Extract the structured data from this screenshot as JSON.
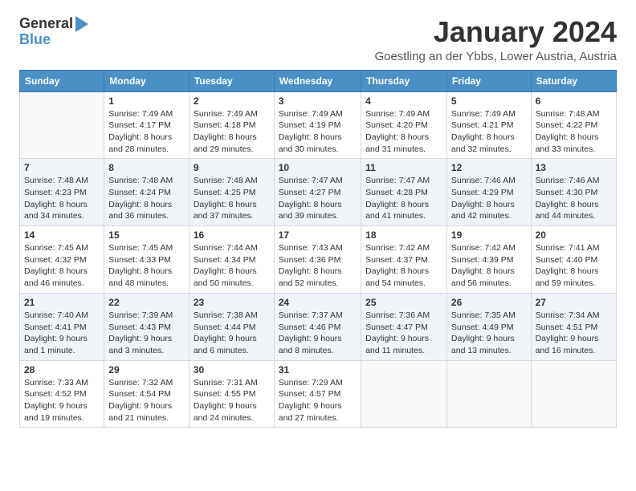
{
  "logo": {
    "text_general": "General",
    "text_blue": "Blue"
  },
  "title": "January 2024",
  "subtitle": "Goestling an der Ybbs, Lower Austria, Austria",
  "days_header": [
    "Sunday",
    "Monday",
    "Tuesday",
    "Wednesday",
    "Thursday",
    "Friday",
    "Saturday"
  ],
  "weeks": [
    [
      {
        "day": "",
        "info": ""
      },
      {
        "day": "1",
        "info": "Sunrise: 7:49 AM\nSunset: 4:17 PM\nDaylight: 8 hours\nand 28 minutes."
      },
      {
        "day": "2",
        "info": "Sunrise: 7:49 AM\nSunset: 4:18 PM\nDaylight: 8 hours\nand 29 minutes."
      },
      {
        "day": "3",
        "info": "Sunrise: 7:49 AM\nSunset: 4:19 PM\nDaylight: 8 hours\nand 30 minutes."
      },
      {
        "day": "4",
        "info": "Sunrise: 7:49 AM\nSunset: 4:20 PM\nDaylight: 8 hours\nand 31 minutes."
      },
      {
        "day": "5",
        "info": "Sunrise: 7:49 AM\nSunset: 4:21 PM\nDaylight: 8 hours\nand 32 minutes."
      },
      {
        "day": "6",
        "info": "Sunrise: 7:48 AM\nSunset: 4:22 PM\nDaylight: 8 hours\nand 33 minutes."
      }
    ],
    [
      {
        "day": "7",
        "info": "Sunrise: 7:48 AM\nSunset: 4:23 PM\nDaylight: 8 hours\nand 34 minutes."
      },
      {
        "day": "8",
        "info": "Sunrise: 7:48 AM\nSunset: 4:24 PM\nDaylight: 8 hours\nand 36 minutes."
      },
      {
        "day": "9",
        "info": "Sunrise: 7:48 AM\nSunset: 4:25 PM\nDaylight: 8 hours\nand 37 minutes."
      },
      {
        "day": "10",
        "info": "Sunrise: 7:47 AM\nSunset: 4:27 PM\nDaylight: 8 hours\nand 39 minutes."
      },
      {
        "day": "11",
        "info": "Sunrise: 7:47 AM\nSunset: 4:28 PM\nDaylight: 8 hours\nand 41 minutes."
      },
      {
        "day": "12",
        "info": "Sunrise: 7:46 AM\nSunset: 4:29 PM\nDaylight: 8 hours\nand 42 minutes."
      },
      {
        "day": "13",
        "info": "Sunrise: 7:46 AM\nSunset: 4:30 PM\nDaylight: 8 hours\nand 44 minutes."
      }
    ],
    [
      {
        "day": "14",
        "info": "Sunrise: 7:45 AM\nSunset: 4:32 PM\nDaylight: 8 hours\nand 46 minutes."
      },
      {
        "day": "15",
        "info": "Sunrise: 7:45 AM\nSunset: 4:33 PM\nDaylight: 8 hours\nand 48 minutes."
      },
      {
        "day": "16",
        "info": "Sunrise: 7:44 AM\nSunset: 4:34 PM\nDaylight: 8 hours\nand 50 minutes."
      },
      {
        "day": "17",
        "info": "Sunrise: 7:43 AM\nSunset: 4:36 PM\nDaylight: 8 hours\nand 52 minutes."
      },
      {
        "day": "18",
        "info": "Sunrise: 7:42 AM\nSunset: 4:37 PM\nDaylight: 8 hours\nand 54 minutes."
      },
      {
        "day": "19",
        "info": "Sunrise: 7:42 AM\nSunset: 4:39 PM\nDaylight: 8 hours\nand 56 minutes."
      },
      {
        "day": "20",
        "info": "Sunrise: 7:41 AM\nSunset: 4:40 PM\nDaylight: 8 hours\nand 59 minutes."
      }
    ],
    [
      {
        "day": "21",
        "info": "Sunrise: 7:40 AM\nSunset: 4:41 PM\nDaylight: 9 hours\nand 1 minute."
      },
      {
        "day": "22",
        "info": "Sunrise: 7:39 AM\nSunset: 4:43 PM\nDaylight: 9 hours\nand 3 minutes."
      },
      {
        "day": "23",
        "info": "Sunrise: 7:38 AM\nSunset: 4:44 PM\nDaylight: 9 hours\nand 6 minutes."
      },
      {
        "day": "24",
        "info": "Sunrise: 7:37 AM\nSunset: 4:46 PM\nDaylight: 9 hours\nand 8 minutes."
      },
      {
        "day": "25",
        "info": "Sunrise: 7:36 AM\nSunset: 4:47 PM\nDaylight: 9 hours\nand 11 minutes."
      },
      {
        "day": "26",
        "info": "Sunrise: 7:35 AM\nSunset: 4:49 PM\nDaylight: 9 hours\nand 13 minutes."
      },
      {
        "day": "27",
        "info": "Sunrise: 7:34 AM\nSunset: 4:51 PM\nDaylight: 9 hours\nand 16 minutes."
      }
    ],
    [
      {
        "day": "28",
        "info": "Sunrise: 7:33 AM\nSunset: 4:52 PM\nDaylight: 9 hours\nand 19 minutes."
      },
      {
        "day": "29",
        "info": "Sunrise: 7:32 AM\nSunset: 4:54 PM\nDaylight: 9 hours\nand 21 minutes."
      },
      {
        "day": "30",
        "info": "Sunrise: 7:31 AM\nSunset: 4:55 PM\nDaylight: 9 hours\nand 24 minutes."
      },
      {
        "day": "31",
        "info": "Sunrise: 7:29 AM\nSunset: 4:57 PM\nDaylight: 9 hours\nand 27 minutes."
      },
      {
        "day": "",
        "info": ""
      },
      {
        "day": "",
        "info": ""
      },
      {
        "day": "",
        "info": ""
      }
    ]
  ]
}
